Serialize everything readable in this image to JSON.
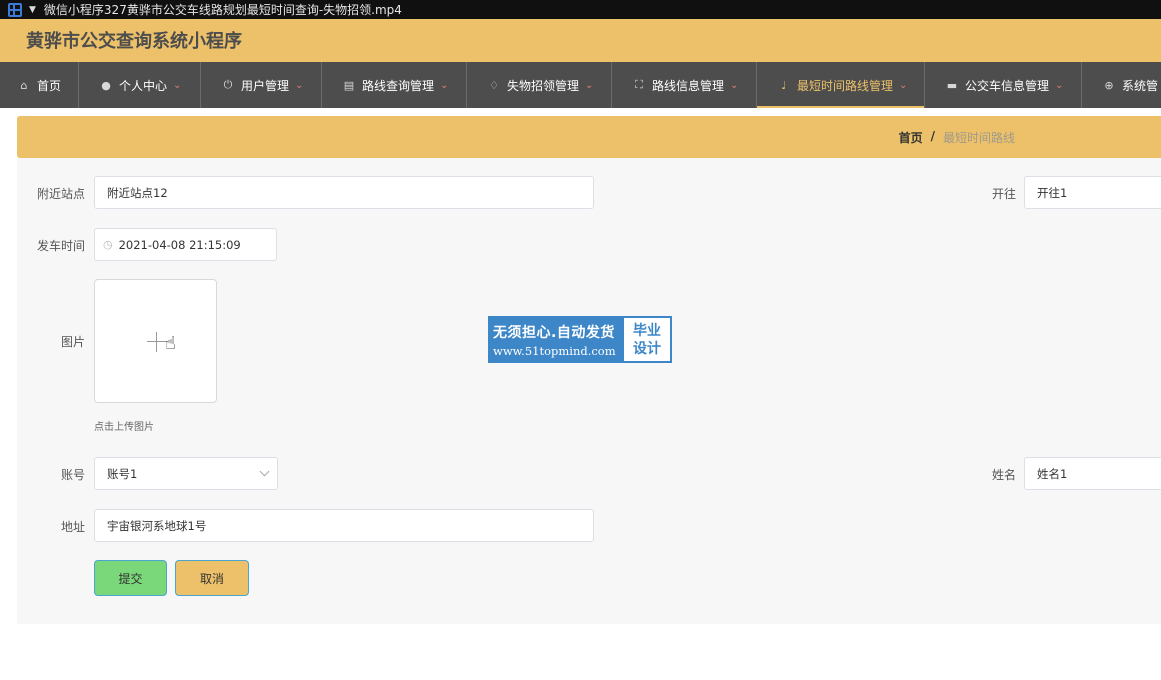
{
  "titlebar": {
    "title": "微信小程序327黄骅市公交车线路规划最短时间查询-失物招领.mp4"
  },
  "header": {
    "app_title": "黄骅市公交查询系统小程序"
  },
  "nav": {
    "items": [
      {
        "label": "首页",
        "icon": "home-icon"
      },
      {
        "label": "个人中心",
        "icon": "user-icon"
      },
      {
        "label": "用户管理",
        "icon": "power-icon"
      },
      {
        "label": "路线查询管理",
        "icon": "document-icon"
      },
      {
        "label": "失物招领管理",
        "icon": "bell-off-icon"
      },
      {
        "label": "路线信息管理",
        "icon": "fullscreen-icon"
      },
      {
        "label": "最短时间路线管理",
        "icon": "microphone-icon"
      },
      {
        "label": "公交车信息管理",
        "icon": "briefcase-icon"
      },
      {
        "label": "系统管",
        "icon": "settings-icon"
      }
    ],
    "active_index": 6
  },
  "breadcrumb": {
    "home": "首页",
    "separator": "/",
    "current": "最短时间路线"
  },
  "form": {
    "nearby_stop": {
      "label": "附近站点",
      "value": "附近站点12"
    },
    "destination": {
      "label": "开往",
      "value": "开往1"
    },
    "departure_time": {
      "label": "发车时间",
      "value": "2021-04-08 21:15:09"
    },
    "image": {
      "label": "图片",
      "tip": "点击上传图片"
    },
    "account": {
      "label": "账号",
      "value": "账号1"
    },
    "name": {
      "label": "姓名",
      "value": "姓名1"
    },
    "address": {
      "label": "地址",
      "value": "宇宙银河系地球1号"
    },
    "submit_label": "提交",
    "cancel_label": "取消"
  },
  "watermark": {
    "line1": "无须担心.自动发货",
    "line2": "www.51topmind.com",
    "right_top": "毕业",
    "right_bottom": "设计"
  },
  "colors": {
    "accent": "#ecc16a",
    "nav_bg": "#4d4d4d",
    "submit": "#7ad77a"
  }
}
